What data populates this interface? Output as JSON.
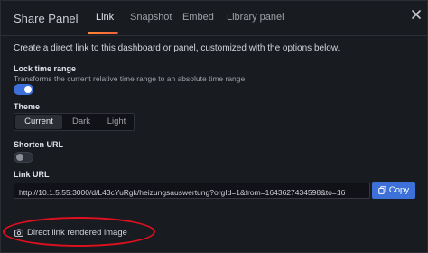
{
  "header": {
    "title": "Share Panel",
    "tabs": [
      {
        "label": "Link",
        "active": true
      },
      {
        "label": "Snapshot",
        "active": false
      },
      {
        "label": "Embed",
        "active": false
      },
      {
        "label": "Library panel",
        "active": false
      }
    ],
    "close_icon": "close-icon"
  },
  "description": "Create a direct link to this dashboard or panel, customized with the options below.",
  "lock_time_range": {
    "label": "Lock time range",
    "sublabel": "Transforms the current relative time range to an absolute time range",
    "enabled": true
  },
  "theme": {
    "label": "Theme",
    "options": [
      "Current",
      "Dark",
      "Light"
    ],
    "selected": "Current"
  },
  "shorten_url": {
    "label": "Shorten URL",
    "enabled": false
  },
  "link_url": {
    "label": "Link URL",
    "value": "http://10.1.5.55:3000/d/L43cYuRgk/heizungsauswertung?orgId=1&from=1643627434598&to=16",
    "copy_label": "Copy",
    "copy_icon": "copy-icon"
  },
  "render_link": {
    "label": "Direct link rendered image",
    "icon": "camera-icon"
  },
  "colors": {
    "accent": "#3d71d9",
    "tab_underline": "#ff8833",
    "annotation": "#e01020"
  }
}
